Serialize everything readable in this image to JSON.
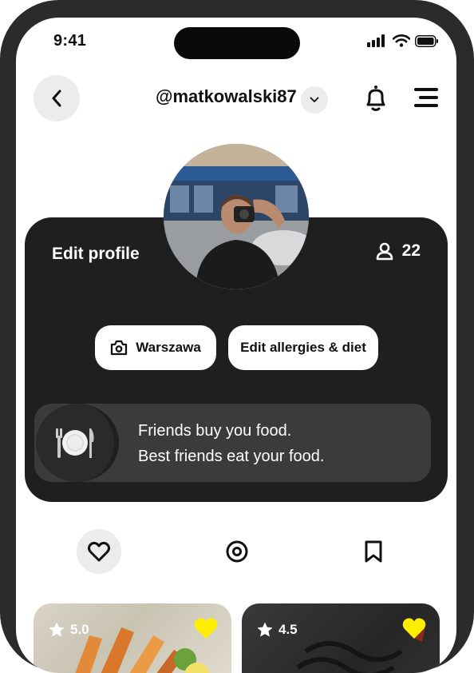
{
  "status_bar": {
    "time": "9:41"
  },
  "header": {
    "username": "@matkowalski87"
  },
  "profile": {
    "edit_label": "Edit profile",
    "friends_count": "22",
    "location_label": "Warszawa",
    "diet_label": "Edit allergies & diet",
    "motto_line1": "Friends buy you food.",
    "motto_line2": "Best friends eat your food."
  },
  "tabs": [
    {
      "icon": "heart-icon",
      "active": true
    },
    {
      "icon": "location-pin-icon",
      "active": false
    },
    {
      "icon": "bookmark-icon",
      "active": false
    }
  ],
  "food_cards": [
    {
      "rating": "5.0",
      "liked": true
    },
    {
      "rating": "4.5",
      "liked": true
    }
  ],
  "colors": {
    "card_bg": "#1f1f1f",
    "accent_heart": "#ffee00",
    "chip_bg": "#ececec"
  }
}
